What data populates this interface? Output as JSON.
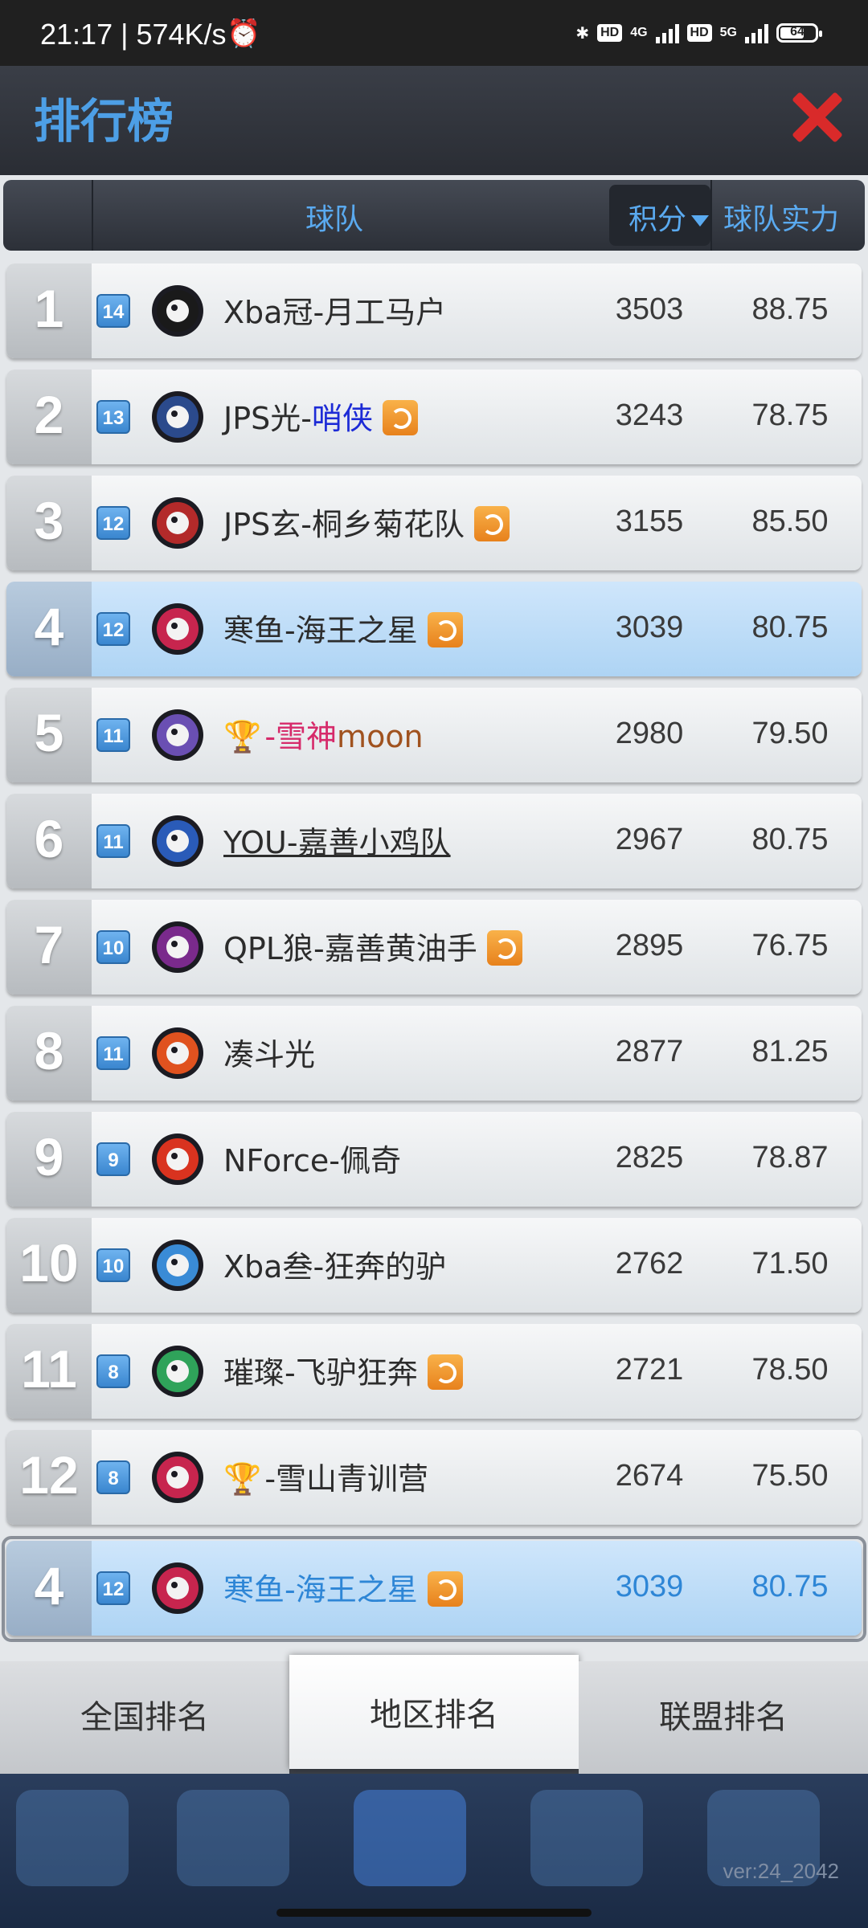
{
  "status_bar": {
    "time": "21:17 | 574K/s",
    "net1": "4G",
    "net2": "5G",
    "battery": "64"
  },
  "header": {
    "title": "排行榜"
  },
  "columns": {
    "team": "球队",
    "score": "积分",
    "power": "球队实力"
  },
  "rows": [
    {
      "rank": "1",
      "level": "14",
      "name": "Xba冠-月工马户",
      "score": "3503",
      "power": "88.75",
      "transfer": false,
      "trophy": false,
      "logo_color": "#1a1a1a"
    },
    {
      "rank": "2",
      "level": "13",
      "name_pre": "JPS光-",
      "name_hl": "哨侠",
      "score": "3243",
      "power": "78.75",
      "transfer": true,
      "trophy": false,
      "logo_color": "#2b4a8c"
    },
    {
      "rank": "3",
      "level": "12",
      "name": "JPS玄-桐乡菊花队",
      "score": "3155",
      "power": "85.50",
      "transfer": true,
      "trophy": false,
      "logo_color": "#b32a2a"
    },
    {
      "rank": "4",
      "level": "12",
      "name": "寒鱼-海王之星",
      "score": "3039",
      "power": "80.75",
      "transfer": true,
      "trophy": false,
      "logo_color": "#c7254e"
    },
    {
      "rank": "5",
      "level": "11",
      "name_pre": "-雪神",
      "name_hl": "moon",
      "score": "2980",
      "power": "79.50",
      "transfer": false,
      "trophy": true,
      "logo_color": "#6a4fb3"
    },
    {
      "rank": "6",
      "level": "11",
      "name": "YOU-嘉善小鸡队",
      "score": "2967",
      "power": "80.75",
      "transfer": false,
      "trophy": false,
      "logo_color": "#2a5bb8"
    },
    {
      "rank": "7",
      "level": "10",
      "name": "QPL狼-嘉善黄油手",
      "score": "2895",
      "power": "76.75",
      "transfer": true,
      "trophy": false,
      "logo_color": "#7a2a8c"
    },
    {
      "rank": "8",
      "level": "11",
      "name": "凑斗光",
      "score": "2877",
      "power": "81.25",
      "transfer": false,
      "trophy": false,
      "logo_color": "#e0521f"
    },
    {
      "rank": "9",
      "level": "9",
      "name": "NForce-佩奇",
      "score": "2825",
      "power": "78.87",
      "transfer": false,
      "trophy": false,
      "logo_color": "#d9331f"
    },
    {
      "rank": "10",
      "level": "10",
      "name": "Xba叁-狂奔的驴",
      "score": "2762",
      "power": "71.50",
      "transfer": false,
      "trophy": false,
      "logo_color": "#3a8bd6"
    },
    {
      "rank": "11",
      "level": "8",
      "name": "璀璨-飞驴狂奔",
      "score": "2721",
      "power": "78.50",
      "transfer": true,
      "trophy": false,
      "logo_color": "#2fa35a"
    },
    {
      "rank": "12",
      "level": "8",
      "name_pre": "-雪山青训营",
      "name_hl": "",
      "score": "2674",
      "power": "75.50",
      "transfer": false,
      "trophy": true,
      "logo_color": "#c7254e"
    }
  ],
  "my_row": {
    "rank": "4",
    "level": "12",
    "name": "寒鱼-海王之星",
    "score": "3039",
    "power": "80.75",
    "transfer": true
  },
  "tabs": [
    "全国排名",
    "地区排名",
    "联盟排名"
  ],
  "active_tab": 1,
  "version": "ver:24_2042",
  "colors": {
    "accent": "#4d9fe6",
    "highlight_row": "#cfe6fb",
    "close": "#d92a2a",
    "moon": "#a0521f",
    "shaoxia": "#1d2bd6",
    "snow_god": "#d62a6a"
  }
}
